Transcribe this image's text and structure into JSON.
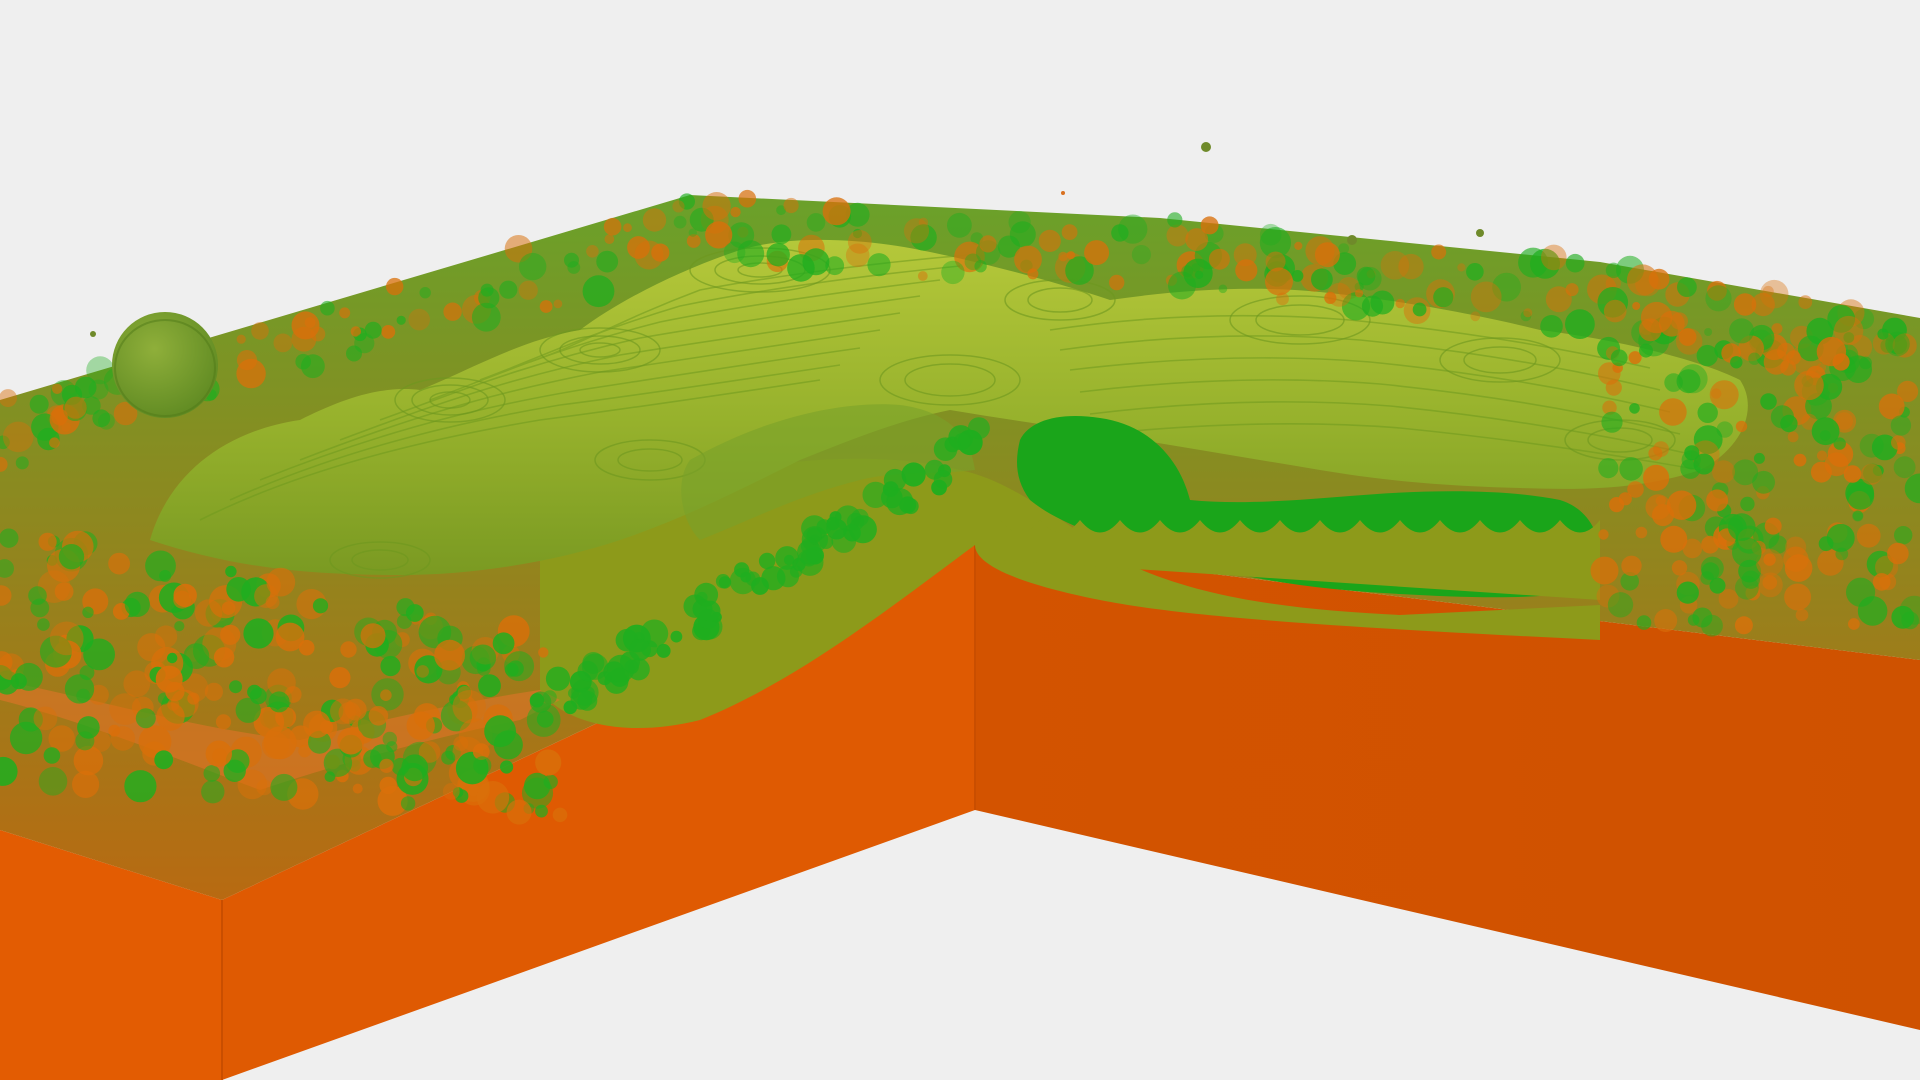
{
  "scene": {
    "background_color": "#efefef",
    "base_color": "#e05a00",
    "base_side_color": "#d45400",
    "base_dark_color": "#c94f00",
    "grain_green": "#1fae1f",
    "grain_orange": "#d9700a",
    "olive_fill": "#8e9a1a",
    "terrain_light": "#9fbf2a",
    "terrain_mid": "#7ea32a",
    "bright_green": "#18a818"
  }
}
